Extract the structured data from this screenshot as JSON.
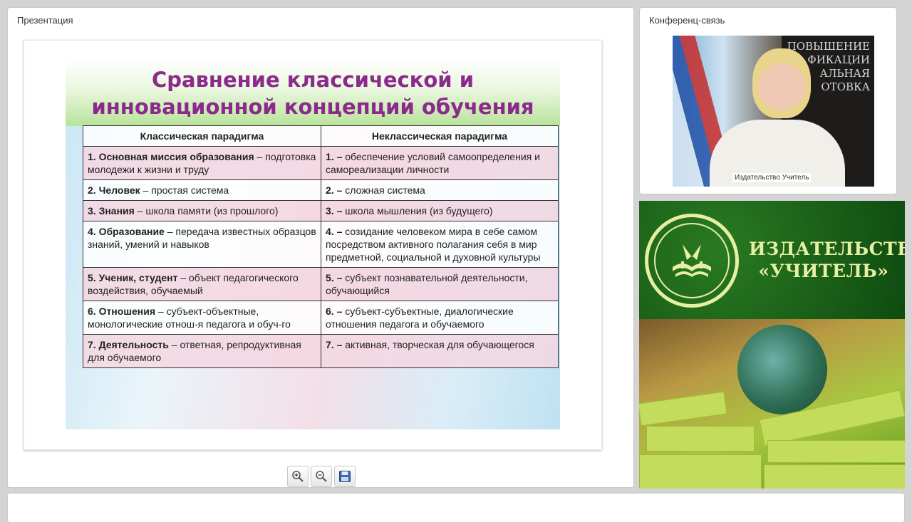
{
  "presentation": {
    "panel_title": "Презентация",
    "slide": {
      "title_line1": "Сравнение классической и",
      "title_line2": "инновационной концепций обучения",
      "headers": [
        "Классическая парадигма",
        "Неклассическая парадигма"
      ],
      "rows": [
        {
          "l_bold": "1. Основная миссия образования",
          "l_text": " – подготовка молодежи к жизни и труду",
          "r_bold": "1.  –",
          "r_text": " обеспечение условий самоопределения и самореализации личности"
        },
        {
          "l_bold": "2. Человек",
          "l_text": " – простая система",
          "r_bold": "2. –",
          "r_text": " сложная система"
        },
        {
          "l_bold": "3. Знания",
          "l_text": " – школа памяти (из прошлого)",
          "r_bold": "3. –",
          "r_text": " школа мышления (из будущего)"
        },
        {
          "l_bold": "4. Образование",
          "l_text": " – передача известных образцов знаний, умений и навыков",
          "r_bold": "4. –",
          "r_text": " созидание человеком мира в себе самом посредством активного полагания себя в мир предметной, социальной и духовной культуры"
        },
        {
          "l_bold": "5. Ученик, студент",
          "l_text": " – объект педагогического воздействия, обучаемый",
          "r_bold": "5. –",
          "r_text": " субъект познавательной деятельности, обучающийся"
        },
        {
          "l_bold": "6. Отношения",
          "l_text": " – субъект-объектные, монологические отнош-я педагога и обуч-го",
          "r_bold": "6. –",
          "r_text": " субъект-субъектные, диалогические отношения педагога и обучаемого"
        },
        {
          "l_bold": "7. Деятельность",
          "l_text": " – ответная, репродуктивная для обучаемого",
          "r_bold": "7. –",
          "r_text": " активная, творческая для обучающегося"
        }
      ]
    },
    "toolbar": {
      "zoom_in": "zoom-in-icon",
      "zoom_out": "zoom-out-icon",
      "save": "save-icon"
    }
  },
  "conference": {
    "panel_title": "Конференц-связь",
    "video_label": "Издательство Учитель",
    "poster_text": [
      "ПОВЫШЕНИЕ",
      "ФИКАЦИИ",
      "АЛЬНАЯ",
      "ОТОВКА"
    ]
  },
  "banner": {
    "line1": "ИЗДАТЕЛЬСТВО",
    "line2": "«УЧИТЕЛЬ»"
  },
  "colors": {
    "slide_title": "#8b2a8c",
    "banner_green": "#0e4b10",
    "banner_text": "#e7efa2"
  }
}
